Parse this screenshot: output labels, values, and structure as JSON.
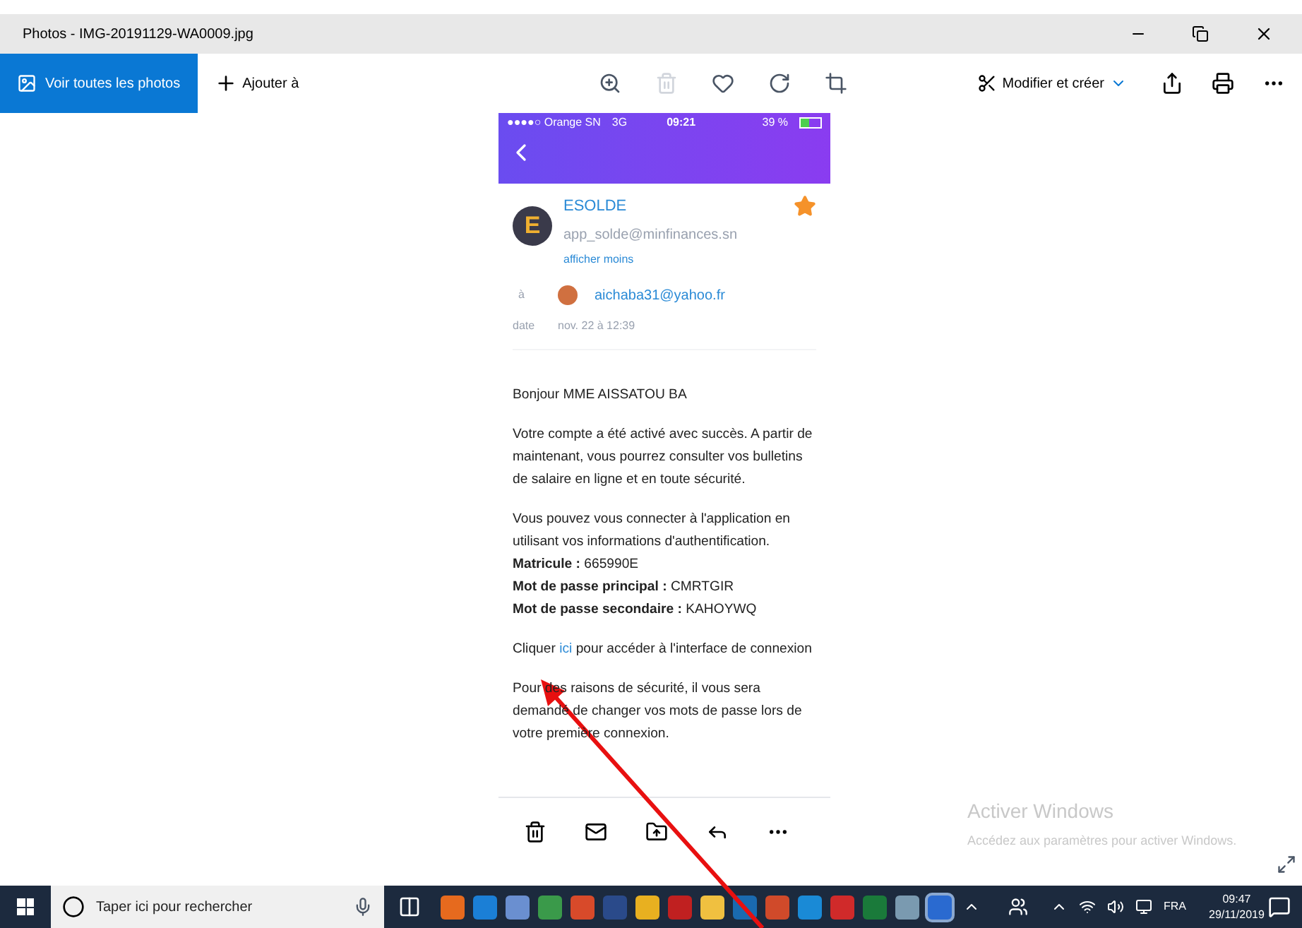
{
  "window": {
    "title": "Photos - IMG-20191129-WA0009.jpg"
  },
  "toolbar": {
    "all_photos": "Voir toutes les photos",
    "add": "Ajouter à",
    "edit": "Modifier et créer"
  },
  "phone": {
    "status_bar": {
      "carrier": "●●●●○ Orange SN",
      "network": "3G",
      "time": "09:21",
      "battery": "39 %"
    },
    "sender": {
      "avatar_letter": "E",
      "name": "ESOLDE",
      "email": "app_solde@minfinances.sn",
      "toggle": "afficher moins",
      "starred": true
    },
    "to_label": "à",
    "recipient": "aichaba31@yahoo.fr",
    "date_label": "date",
    "date": "nov. 22 à 12:39",
    "body": [
      {
        "kind": "text",
        "lines": [
          "Bonjour MME AISSATOU BA"
        ]
      },
      {
        "kind": "text",
        "lines": [
          "Votre compte a été activé avec succès. A partir de maintenant, vous pourrez consulter vos bulletins de salaire en ligne et en toute sécurité."
        ]
      },
      {
        "kind": "text",
        "lines": [
          "Vous pouvez vous connecter à l'application en utilisant vos informations d'authentification.",
          "**Matricule :** 665990E",
          "**Mot de passe principal :** CMRTGIR",
          "**Mot de passe secondaire :** KAHOYWQ"
        ]
      },
      {
        "kind": "link",
        "before": "Cliquer",
        "link": "ici",
        "after": "pour accéder à l'interface de connexion"
      },
      {
        "kind": "text",
        "lines": [
          "Pour des raisons de sécurité, il vous sera demandé de changer vos mots de passe lors de votre première connexion."
        ]
      }
    ]
  },
  "activation": {
    "title": "Activer Windows",
    "subtitle": "Accédez aux paramètres pour activer Windows."
  },
  "taskbar": {
    "search_placeholder": "Taper ici pour rechercher",
    "language": "FRA",
    "time": "09:47",
    "date": "29/11/2019"
  }
}
